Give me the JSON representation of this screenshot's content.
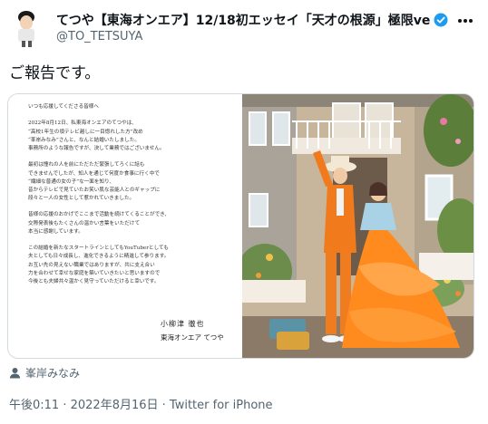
{
  "author": {
    "display_name": "てつや【東海オンエア】12/18初エッセイ「天才の根源」極限ve…",
    "handle": "@TO_TETSUYA"
  },
  "icons": {
    "more": "more-horizontal-icon",
    "verified": "verified-badge-icon",
    "tag": "person-tag-icon"
  },
  "colors": {
    "verified": "#1d9bf0",
    "secondary_text": "#536471",
    "border": "#cfd9de",
    "dress": "#ff8a1e"
  },
  "tweet": {
    "text": "ご報告です。"
  },
  "letter": {
    "lines": [
      "いつも応援してくださる皆様へ",
      "",
      "2022年8月12日、私東海オンエアのてつやは、",
      "“高校1年生の頃テレビ越しに一目惚れした方”改め",
      "“峯岸みなみ”さんと、なんと結婚いたしました。",
      "事務所のような報告ですが、決して業務ではございません。",
      "",
      "最初は憧れの人を前にただただ緊張してろくに話も",
      "できませんでしたが、知人を通じて何度か食事に行く中で",
      "“繊細な普通の女の子”な一面を知り、",
      "昔からテレビで見ていたお笑い肌な芸能人とのギャップに",
      "段々と一人の女性として惹かれていきました。",
      "",
      "皆様の応援のおかげでここまで活動を続けてくることができ、",
      "交際発表後もたくさんの温かい言葉をいただけて",
      "本当に感謝しています。",
      "",
      "この結婚を新たなスタートラインとしてもYouTuberとしても",
      "夫としても日々成長し、進化できるように精進して参ります。",
      "お互い先の見えない職業ではありますが、共に支え合い",
      "力を合わせて幸せな家庭を築いていきたいと思いますので",
      "今後とも夫婦共々温かく見守っていただけると幸いです。"
    ],
    "signature_name": "小柳津 徹也",
    "signature_group": "東海オンエア てつや"
  },
  "tagged_user": "峯岸みなみ",
  "meta": {
    "time": "午後0:11",
    "separator": " · ",
    "date": "2022年8月16日",
    "source": "Twitter for iPhone"
  }
}
